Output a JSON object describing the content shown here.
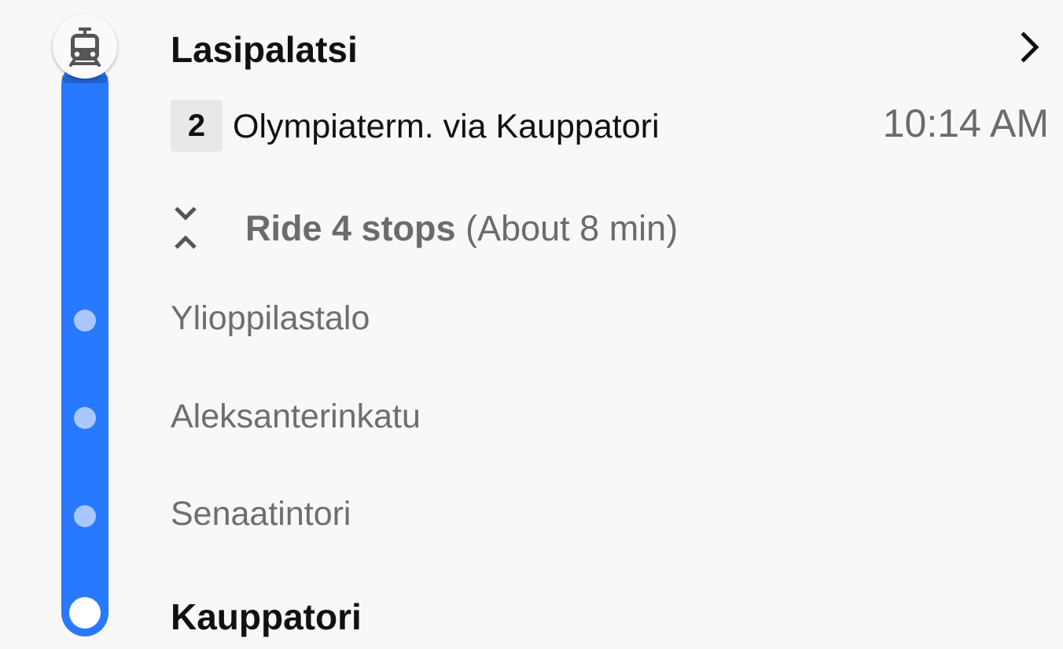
{
  "colors": {
    "route_line": "#2979ff",
    "intermediate_stop": "#a9c8ff",
    "primary_text": "#111111",
    "secondary_text": "#6b6b6b"
  },
  "origin": {
    "name": "Lasipalatsi",
    "icon": "tram-icon"
  },
  "line": {
    "number": "2",
    "headsign": "Olympiaterm. via Kauppatori",
    "departure_time": "10:14 AM"
  },
  "ride": {
    "stops_label": "Ride 4 stops",
    "duration_label": "(About 8 min)",
    "toggle_icon": "expand-collapse-icon"
  },
  "intermediate_stops": [
    {
      "name": "Ylioppilastalo"
    },
    {
      "name": "Aleksanterinkatu"
    },
    {
      "name": "Senaatintori"
    }
  ],
  "destination": {
    "name": "Kauppatori"
  }
}
